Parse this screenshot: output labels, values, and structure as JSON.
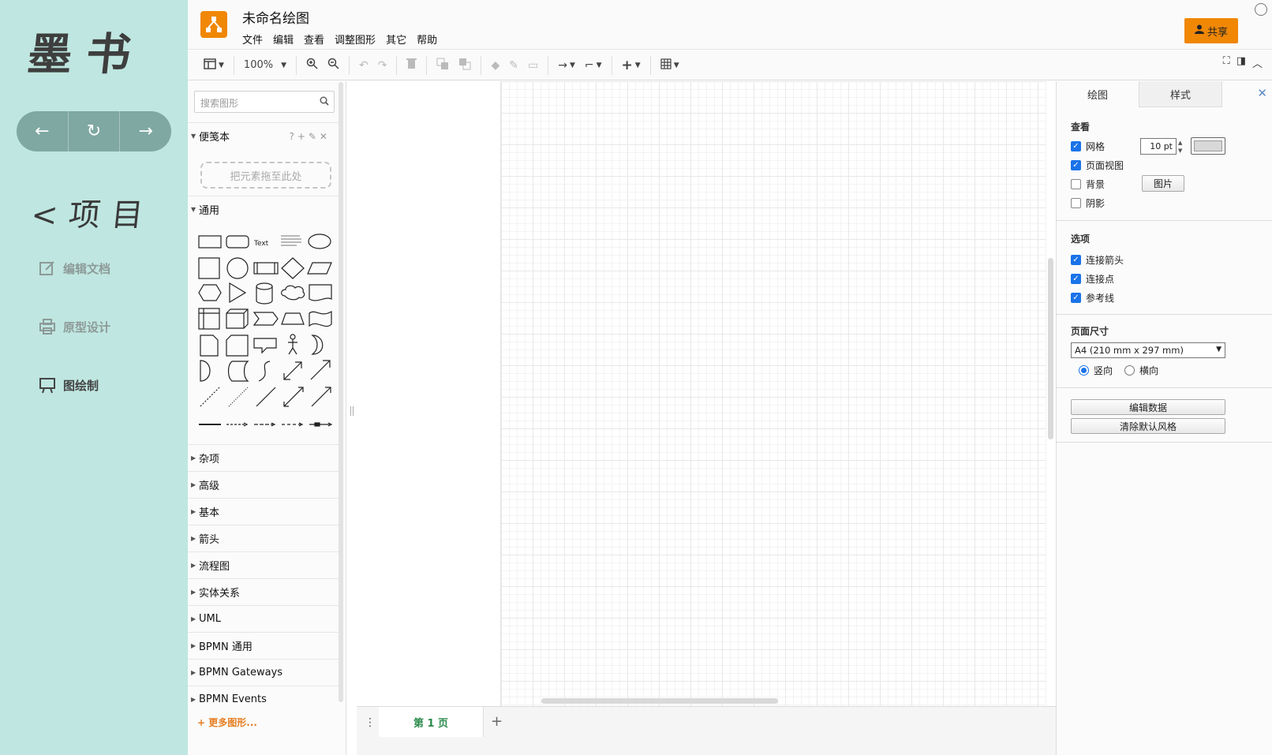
{
  "app": {
    "logo_text": "墨书",
    "nav": [
      "←",
      "↻",
      "→"
    ],
    "project_title": "<项目",
    "links": [
      {
        "label": "编辑文档",
        "icon": "edit-icon"
      },
      {
        "label": "原型设计",
        "icon": "printer-icon"
      },
      {
        "label": "图绘制",
        "icon": "board-icon"
      }
    ]
  },
  "header": {
    "title": "未命名绘图",
    "menu": [
      "文件",
      "编辑",
      "查看",
      "调整图形",
      "其它",
      "帮助"
    ],
    "share_label": "共享"
  },
  "toolbar": {
    "zoom": "100%"
  },
  "shapes": {
    "search_placeholder": "搜索图形",
    "scratchpad_label": "便笺本",
    "scratch_tools": "?+✎✕",
    "drop_hint": "把元素拖至此处",
    "general_label": "通用",
    "text_shape_label": "Text",
    "sections": [
      "杂项",
      "高级",
      "基本",
      "箭头",
      "流程图",
      "实体关系",
      "UML",
      "BPMN 通用",
      "BPMN Gateways",
      "BPMN Events"
    ],
    "more_shapes": "更多图形..."
  },
  "pages": {
    "tab": "第 1 页"
  },
  "format": {
    "tabs": [
      "绘图",
      "样式"
    ],
    "view_heading": "查看",
    "grid_label": "网格",
    "grid_size": "10 pt",
    "page_view_label": "页面视图",
    "background_label": "背景",
    "image_button": "图片",
    "shadow_label": "阴影",
    "options_heading": "选项",
    "connection_arrows": "连接箭头",
    "connection_points": "连接点",
    "guides": "参考线",
    "page_size_heading": "页面尺寸",
    "page_size_value": "A4 (210 mm x 297 mm)",
    "portrait": "竖向",
    "landscape": "横向",
    "edit_data": "编辑数据",
    "clear_style": "清除默认风格"
  },
  "colors": {
    "accent": "#f08705",
    "sidebar_bg": "#bfe6e0",
    "nav_pill": "#7ea8a1",
    "grid_swatch": "#d8d8d8"
  }
}
